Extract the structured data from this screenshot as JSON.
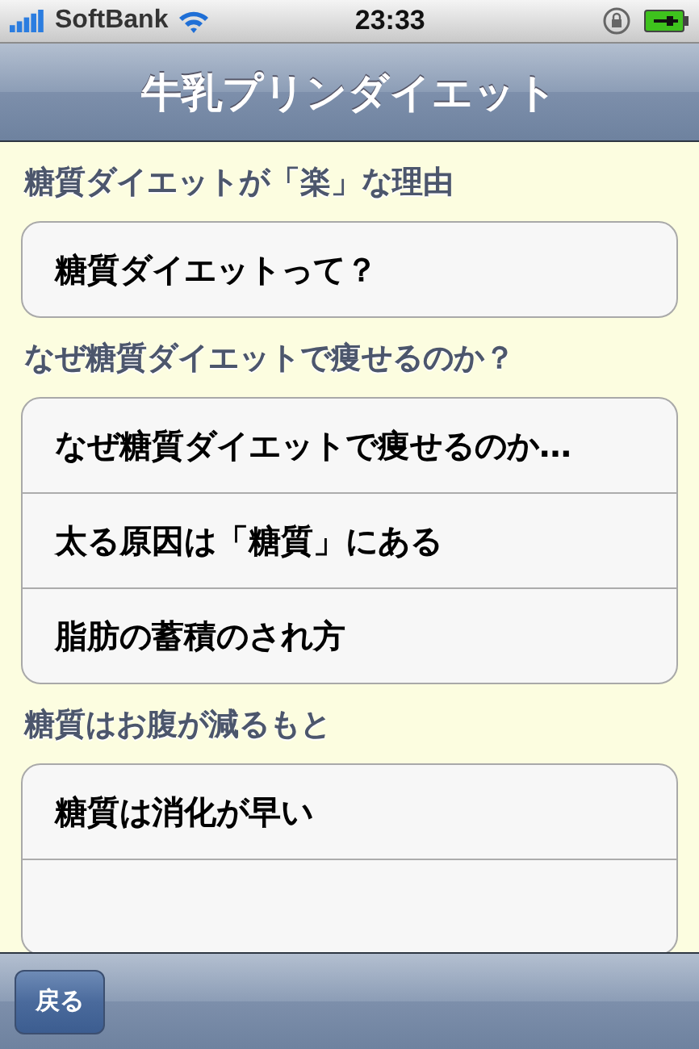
{
  "status_bar": {
    "carrier": "SoftBank",
    "time": "23:33"
  },
  "nav_bar": {
    "title": "牛乳プリンダイエット"
  },
  "sections": [
    {
      "header": "糖質ダイエットが「楽」な理由",
      "items": [
        {
          "label": "糖質ダイエットって？"
        }
      ]
    },
    {
      "header": "なぜ糖質ダイエットで痩せるのか？",
      "items": [
        {
          "label": "なぜ糖質ダイエットで痩せるのか…"
        },
        {
          "label": "太る原因は「糖質」にある"
        },
        {
          "label": "脂肪の蓄積のされ方"
        }
      ]
    },
    {
      "header": "糖質はお腹が減るもと",
      "items": [
        {
          "label": "糖質は消化が早い"
        }
      ],
      "more_below": true
    }
  ],
  "toolbar": {
    "back_button": "戻る"
  }
}
